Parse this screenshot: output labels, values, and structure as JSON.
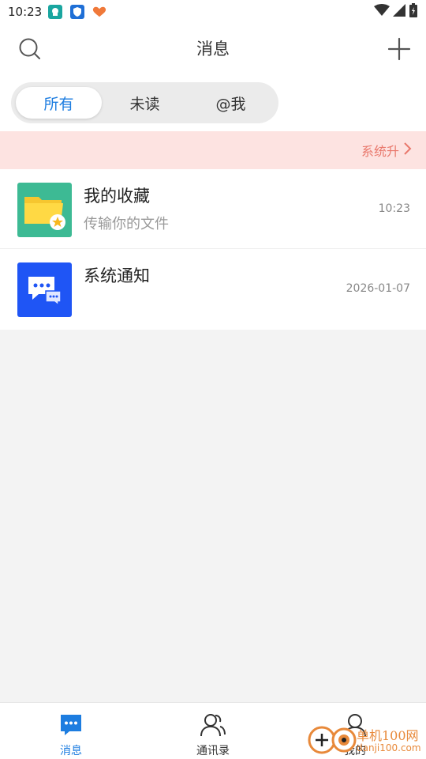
{
  "status_bar": {
    "time": "10:23"
  },
  "header": {
    "title": "消息"
  },
  "tabs": [
    {
      "label": "所有",
      "active": true
    },
    {
      "label": "未读",
      "active": false
    },
    {
      "label": "@我",
      "active": false
    }
  ],
  "banner": {
    "text": "系统升"
  },
  "chats": [
    {
      "name": "我的收藏",
      "preview": "传输你的文件",
      "time": "10:23",
      "avatar_icon": "folder-star-icon",
      "avatar_color": "#3dba94"
    },
    {
      "name": "系统通知",
      "preview": "",
      "time": "2026-01-07",
      "avatar_icon": "chat-bubbles-icon",
      "avatar_color": "#1f55f5"
    }
  ],
  "bottom_nav": {
    "items": [
      {
        "label": "消息",
        "icon": "chat-icon",
        "active": true
      },
      {
        "label": "通讯录",
        "icon": "contacts-icon",
        "active": false
      },
      {
        "label": "我的",
        "icon": "profile-icon",
        "active": false
      }
    ]
  },
  "watermark": {
    "line1": "单机100网",
    "line2": "danji100.com"
  },
  "colors": {
    "accent": "#1d7de0",
    "banner_bg": "#fde3e1",
    "banner_text": "#e9786c"
  }
}
